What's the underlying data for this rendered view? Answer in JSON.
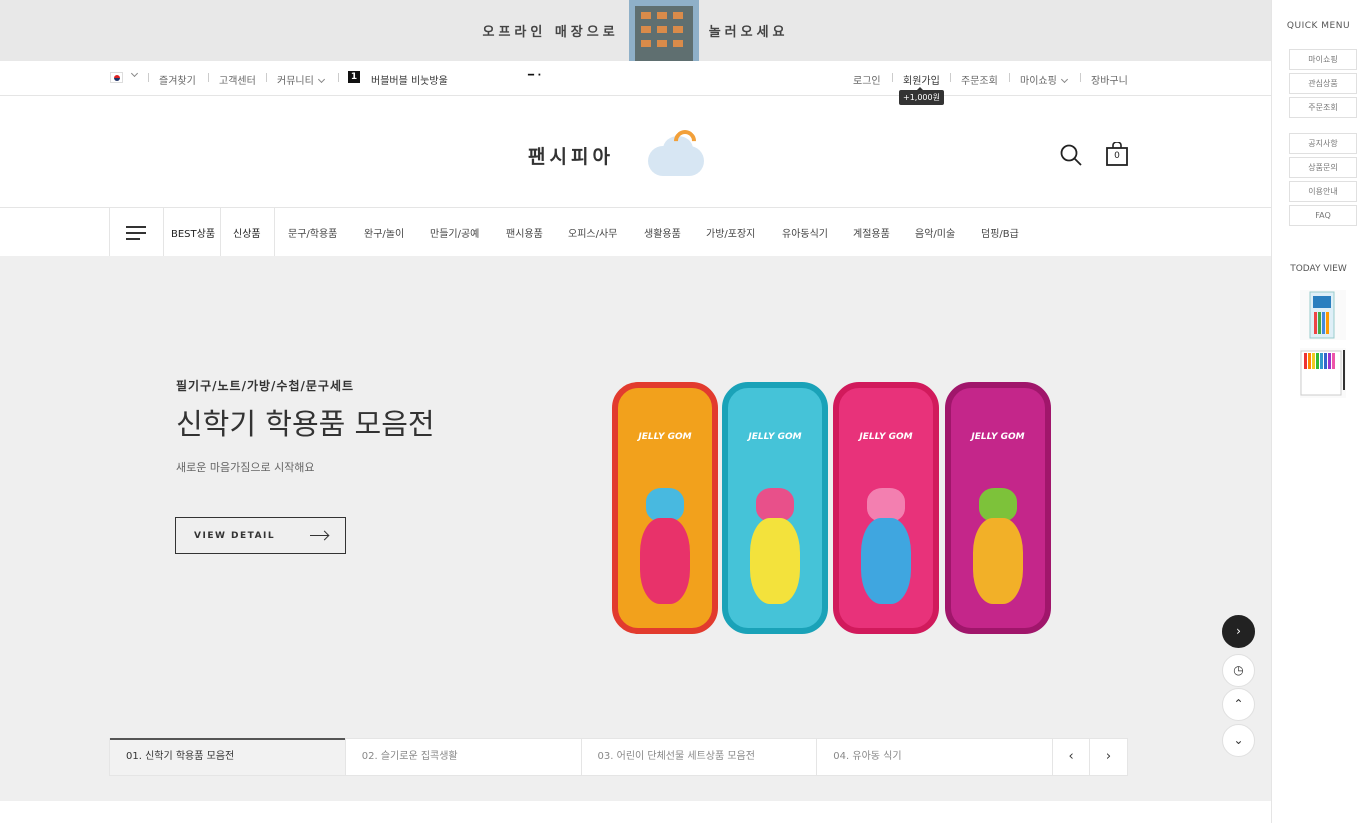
{
  "top_banner": {
    "text_left": "오프라인 매장으로",
    "text_right": "놀러오세요"
  },
  "util_bar": {
    "left": {
      "favorites": "즐겨찾기",
      "customer_center": "고객센터",
      "community": "커뮤니티",
      "notice_number": "1",
      "notice_text": "버블버블 비눗방울"
    },
    "right": {
      "login": "로그인",
      "join": "회원가입",
      "order_lookup": "주문조회",
      "my_shopping": "마이쇼핑",
      "cart": "장바구니"
    },
    "join_tooltip": "+1,000원"
  },
  "header": {
    "logo_text": "팬시피아",
    "cart_count": "0"
  },
  "gnb": {
    "items": [
      "BEST상품",
      "신상품",
      "문구/학용품",
      "완구/놀이",
      "만들기/공예",
      "팬시용품",
      "오피스/사무",
      "생활용품",
      "가방/포장지",
      "유아동식기",
      "계절용품",
      "음악/미술",
      "덤핑/B급"
    ]
  },
  "hero": {
    "subtitle": "필기구/노트/가방/수첩/문구세트",
    "title": "신학기 학용품 모음전",
    "description": "새로운 마음가짐으로 시작해요",
    "button": "VIEW DETAIL",
    "case_label": "JELLY GOM",
    "case_colors": [
      "#f2a11c",
      "#45c3d8",
      "#e8327a",
      "#c4268a"
    ],
    "case_border_colors": [
      "#e23b2e",
      "#1aa2b8",
      "#d11a5c",
      "#a0166b"
    ]
  },
  "slide_tabs": [
    "01. 신학기 학용품 모음전",
    "02. 슬기로운 집콕생활",
    "03. 어린이 단체선물 세트상품 모음전",
    "04. 유아동 식기"
  ],
  "quick_menu": {
    "title": "QUICK MENU",
    "group1": [
      "마이쇼핑",
      "관심상품",
      "주문조회"
    ],
    "group2": [
      "공지사항",
      "상품문의",
      "이용안내",
      "FAQ"
    ],
    "today_view": "TODAY VIEW"
  }
}
